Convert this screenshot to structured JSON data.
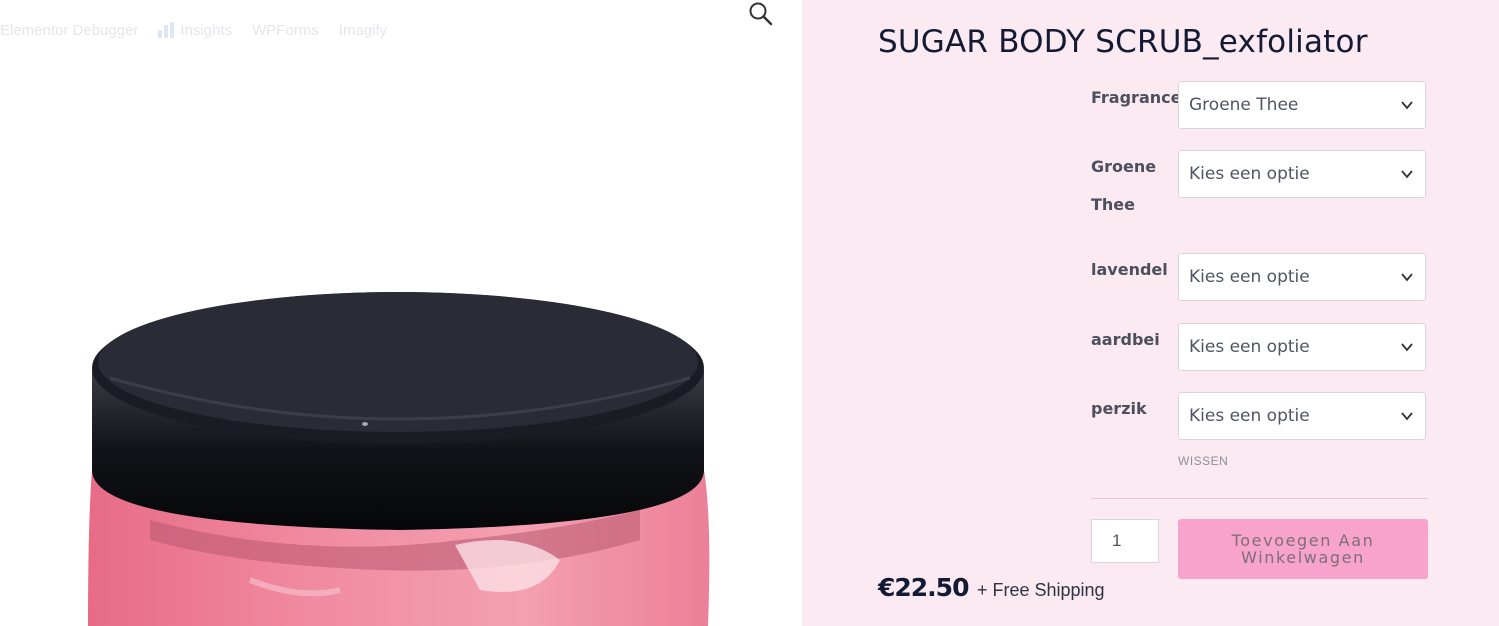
{
  "admin_bar": {
    "items": [
      "Elementor Debugger",
      "Insights",
      "WPForms",
      "Imagify"
    ]
  },
  "icons": {
    "search": "search-icon",
    "chevron": "chevron-down-icon",
    "insights": "bar-chart-icon"
  },
  "product": {
    "title": "SUGAR BODY SCRUB_exfoliator",
    "variations": [
      {
        "label": "Fragrance",
        "value": "Groene Thee"
      },
      {
        "label": "Groene Thee",
        "value": "Kies een optie"
      },
      {
        "label": "lavendel",
        "value": "Kies een optie"
      },
      {
        "label": "aardbei",
        "value": "Kies een optie"
      },
      {
        "label": "perzik",
        "value": "Kies een optie"
      }
    ],
    "clear_label": "WISSEN",
    "quantity": "1",
    "add_to_cart_label": "Toevoegen Aan Winkelwagen",
    "price": "€22.50",
    "shipping": "+ Free Shipping"
  },
  "colors": {
    "panel_bg": "#fbeaf2",
    "button_bg": "#f7a3cc",
    "title": "#131a33"
  }
}
